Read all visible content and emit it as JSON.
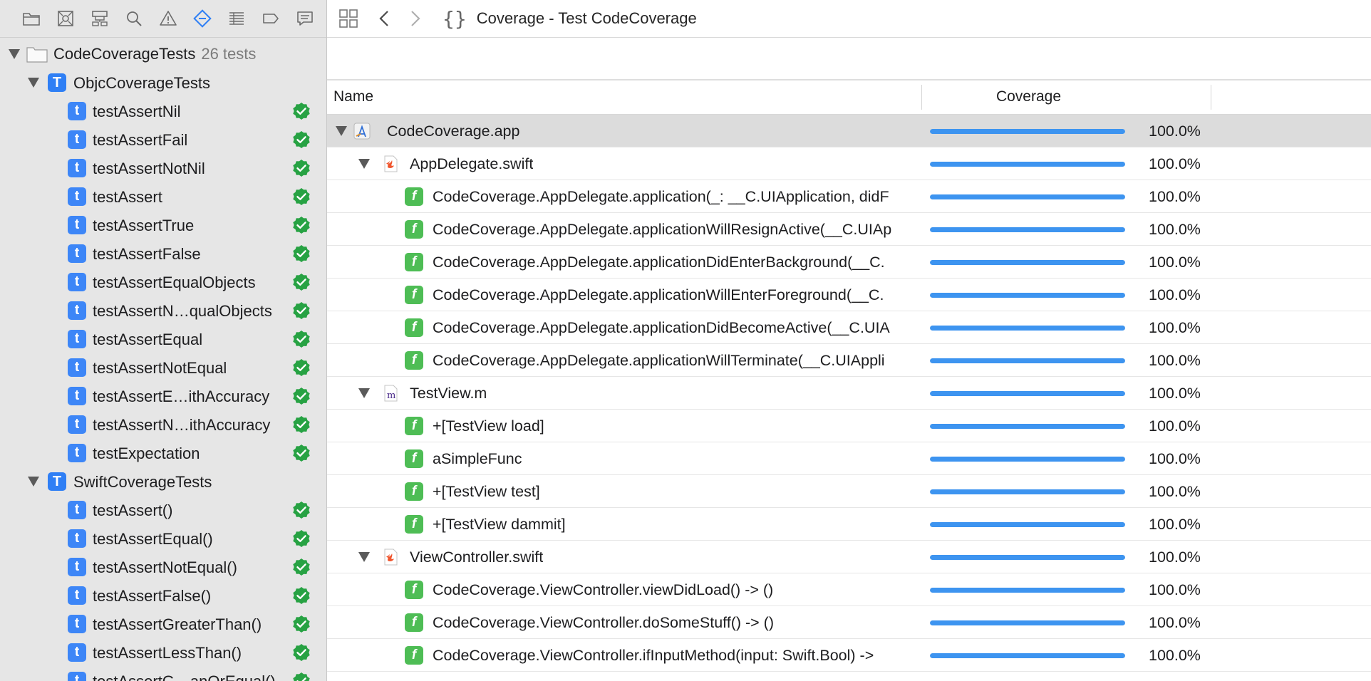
{
  "navigator": {
    "icons": [
      "folder-icon",
      "source-control-icon",
      "symbol-hierarchy-icon",
      "search-icon",
      "warning-icon",
      "test-navigator-icon",
      "debug-list-icon",
      "breakpoint-icon",
      "report-icon"
    ],
    "root": {
      "label": "CodeCoverageTests",
      "count": "26 tests"
    },
    "groups": [
      {
        "label": "ObjcCoverageTests",
        "tests": [
          "testAssertNil",
          "testAssertFail",
          "testAssertNotNil",
          "testAssert",
          "testAssertTrue",
          "testAssertFalse",
          "testAssertEqualObjects",
          "testAssertN…qualObjects",
          "testAssertEqual",
          "testAssertNotEqual",
          "testAssertE…ithAccuracy",
          "testAssertN…ithAccuracy",
          "testExpectation"
        ]
      },
      {
        "label": "SwiftCoverageTests",
        "tests": [
          "testAssert()",
          "testAssertEqual()",
          "testAssertNotEqual()",
          "testAssertFalse()",
          "testAssertGreaterThan()",
          "testAssertLessThan()",
          "testAssertG…anOrEqual()"
        ]
      }
    ]
  },
  "jump_bar": {
    "title": "Coverage - Test CodeCoverage"
  },
  "table": {
    "columns": {
      "name": "Name",
      "coverage": "Coverage"
    },
    "rows": [
      {
        "level": 0,
        "kind": "app",
        "name": "CodeCoverage.app",
        "coverage": "100.0%",
        "fill": 1.0,
        "expanded": true,
        "selected": true
      },
      {
        "level": 1,
        "kind": "swift",
        "name": "AppDelegate.swift",
        "coverage": "100.0%",
        "fill": 1.0,
        "expanded": true
      },
      {
        "level": 2,
        "kind": "func",
        "name": "CodeCoverage.AppDelegate.application(_: __C.UIApplication, didF",
        "coverage": "100.0%",
        "fill": 1.0
      },
      {
        "level": 2,
        "kind": "func",
        "name": "CodeCoverage.AppDelegate.applicationWillResignActive(__C.UIAp",
        "coverage": "100.0%",
        "fill": 1.0
      },
      {
        "level": 2,
        "kind": "func",
        "name": "CodeCoverage.AppDelegate.applicationDidEnterBackground(__C.",
        "coverage": "100.0%",
        "fill": 1.0
      },
      {
        "level": 2,
        "kind": "func",
        "name": "CodeCoverage.AppDelegate.applicationWillEnterForeground(__C.",
        "coverage": "100.0%",
        "fill": 1.0
      },
      {
        "level": 2,
        "kind": "func",
        "name": "CodeCoverage.AppDelegate.applicationDidBecomeActive(__C.UIA",
        "coverage": "100.0%",
        "fill": 1.0
      },
      {
        "level": 2,
        "kind": "func",
        "name": "CodeCoverage.AppDelegate.applicationWillTerminate(__C.UIAppli",
        "coverage": "100.0%",
        "fill": 1.0
      },
      {
        "level": 1,
        "kind": "objc",
        "name": "TestView.m",
        "coverage": "100.0%",
        "fill": 1.0,
        "expanded": true
      },
      {
        "level": 2,
        "kind": "func",
        "name": "+[TestView load]",
        "coverage": "100.0%",
        "fill": 1.0
      },
      {
        "level": 2,
        "kind": "func",
        "name": "aSimpleFunc",
        "coverage": "100.0%",
        "fill": 1.0
      },
      {
        "level": 2,
        "kind": "func",
        "name": "+[TestView test]",
        "coverage": "100.0%",
        "fill": 1.0
      },
      {
        "level": 2,
        "kind": "func",
        "name": "+[TestView dammit]",
        "coverage": "100.0%",
        "fill": 1.0
      },
      {
        "level": 1,
        "kind": "swift",
        "name": "ViewController.swift",
        "coverage": "100.0%",
        "fill": 1.0,
        "expanded": true
      },
      {
        "level": 2,
        "kind": "func",
        "name": "CodeCoverage.ViewController.viewDidLoad() -> ()",
        "coverage": "100.0%",
        "fill": 1.0
      },
      {
        "level": 2,
        "kind": "func",
        "name": "CodeCoverage.ViewController.doSomeStuff() -> ()",
        "coverage": "100.0%",
        "fill": 1.0
      },
      {
        "level": 2,
        "kind": "func",
        "name": "CodeCoverage.ViewController.ifInputMethod(input: Swift.Bool) ->",
        "coverage": "100.0%",
        "fill": 1.0
      }
    ]
  },
  "colors": {
    "accent": "#3d94f0",
    "pass": "#27a243",
    "test_badge": "#3d86f7",
    "func_badge": "#4ebd55"
  }
}
